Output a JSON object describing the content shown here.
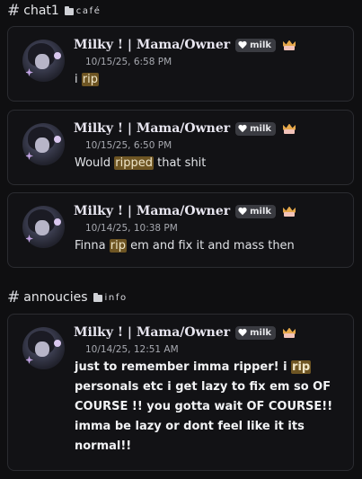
{
  "sections": [
    {
      "hash": "#",
      "name": "chat1",
      "category": "café"
    },
    {
      "hash": "#",
      "name": "annoucies",
      "category": "info"
    }
  ],
  "author": {
    "name": "Milky ! | Mama/Owner",
    "badge_label": "milk",
    "heart_icon": "white-heart-icon",
    "crown_icon": "crown-icon"
  },
  "messages": [
    {
      "timestamp": "10/15/25, 6:58 PM",
      "before": "i ",
      "match": "rip",
      "after": ""
    },
    {
      "timestamp": "10/15/25, 6:50 PM",
      "before": "Would ",
      "match": "ripped",
      "after": " that shit"
    },
    {
      "timestamp": "10/14/25, 10:38 PM",
      "before": "Finna ",
      "match": "rip",
      "after": " em and fix it and mass then"
    },
    {
      "timestamp": "10/14/25, 12:51 AM",
      "before": "just to remember imma ripper! i ",
      "match": "rip",
      "after": " personals etc i get lazy to fix em so OF COURSE !! you gotta wait OF COURSE!! imma be lazy or dont feel like it its normal!!"
    }
  ],
  "colors": {
    "background": "#0f0f11",
    "card": "#121215",
    "highlight": "#6e5523"
  }
}
